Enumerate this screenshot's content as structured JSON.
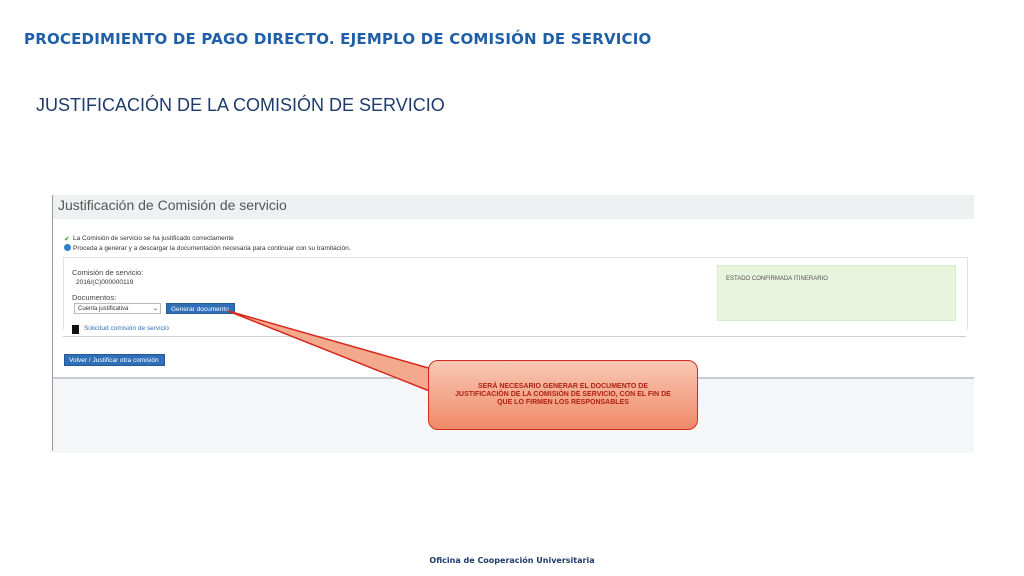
{
  "slide": {
    "title": "PROCEDIMIENTO DE PAGO DIRECTO. EJEMPLO DE COMISIÓN DE SERVICIO",
    "subtitle": "JUSTIFICACIÓN DE LA COMISIÓN DE SERVICIO",
    "footer": "Oficina de Cooperación Universitaria"
  },
  "app": {
    "title": "Justificación de Comisión de servicio",
    "messages": {
      "success": "La Comisión de servicio se ha justificado correctamente",
      "info": "Proceda a generar y a descargar la documentación necesaria para continuar con su tramitación."
    },
    "commission_label": "Comisión de servicio:",
    "commission_value": "2016/(C)000000119",
    "documents_label": "Documentos:",
    "documents_select_value": "Cuenta justificativa",
    "generate_button": "Generar documento",
    "request_link": "Solicitud comisión de servicio",
    "status_text": "ESTADO CONFIRMADA ITINERARIO",
    "back_button": "Volver / Justificar otra comisión"
  },
  "callout": {
    "text": "SERÁ NECESARIO GENERAR EL DOCUMENTO DE JUSTIFICACIÓN DE LA COMISIÓN DE SERVICIO, CON EL FIN DE QUE LO FIRMEN LOS RESPONSABLES"
  },
  "colors": {
    "title_blue": "#1f5fa8",
    "button_blue": "#2f6fb7",
    "callout_border": "#d42a1e",
    "status_bg": "#e8f4dc"
  }
}
